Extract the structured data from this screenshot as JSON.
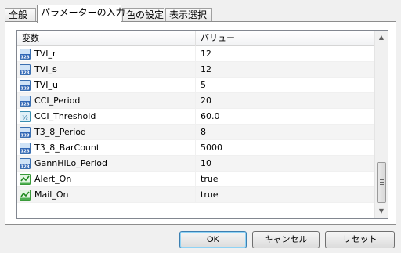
{
  "tabs": [
    {
      "label": "全般"
    },
    {
      "label": "パラメーターの入力"
    },
    {
      "label": "色の設定"
    },
    {
      "label": "表示選択"
    }
  ],
  "grid": {
    "col_name": "変数",
    "col_value": "バリュー",
    "rows": [
      {
        "name": "TVI_r",
        "value": "12",
        "icon": "integer-icon"
      },
      {
        "name": "TVI_s",
        "value": "12",
        "icon": "integer-icon"
      },
      {
        "name": "TVI_u",
        "value": "5",
        "icon": "integer-icon"
      },
      {
        "name": "CCI_Period",
        "value": "20",
        "icon": "integer-icon"
      },
      {
        "name": "CCI_Threshold",
        "value": "60.0",
        "icon": "double-icon"
      },
      {
        "name": "T3_8_Period",
        "value": "8",
        "icon": "integer-icon"
      },
      {
        "name": "T3_8_BarCount",
        "value": "5000",
        "icon": "integer-icon"
      },
      {
        "name": "GannHiLo_Period",
        "value": "10",
        "icon": "integer-icon"
      },
      {
        "name": "Alert_On",
        "value": "true",
        "icon": "boolean-icon"
      },
      {
        "name": "Mail_On",
        "value": "true",
        "icon": "boolean-icon"
      }
    ]
  },
  "buttons": {
    "ok": "OK",
    "cancel": "キャンセル",
    "reset": "リセット"
  }
}
